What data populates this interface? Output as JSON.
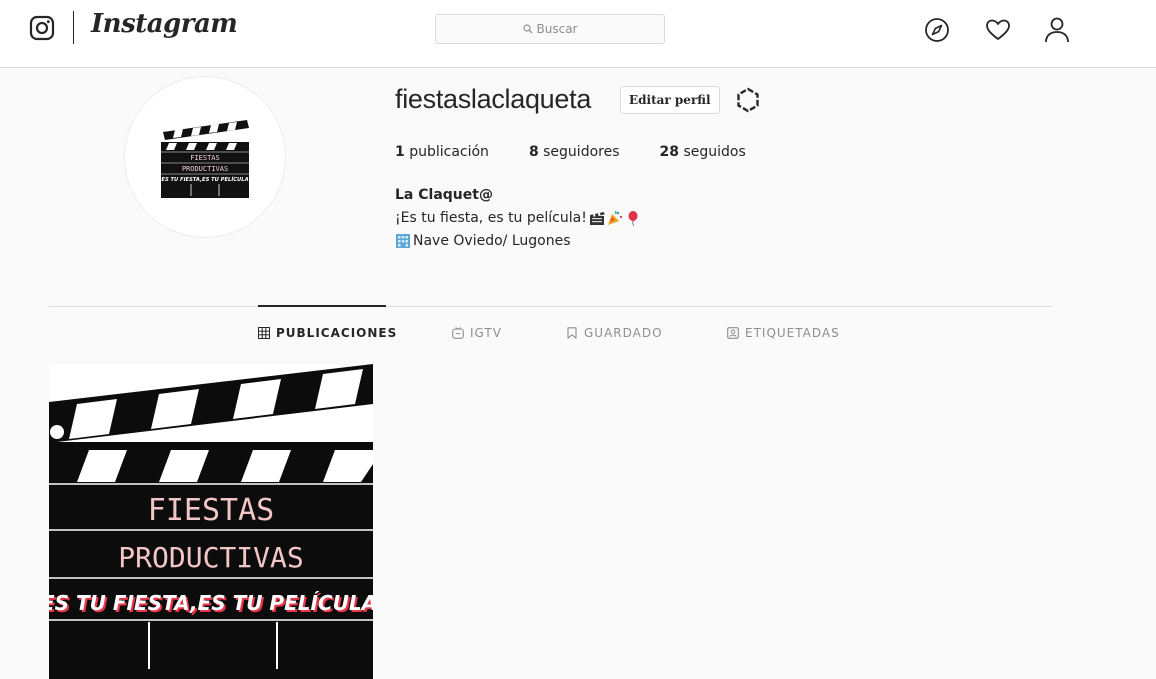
{
  "nav": {
    "wordmark": "Instagram",
    "search_placeholder": "Buscar",
    "icons": [
      "instagram-glyph-icon",
      "compass-icon",
      "heart-icon",
      "person-icon"
    ]
  },
  "profile": {
    "username": "fiestaslaclaqueta",
    "edit_label": "Editar perfil",
    "stats": [
      {
        "count": "1",
        "label": "publicación"
      },
      {
        "count": "8",
        "label": "seguidores"
      },
      {
        "count": "28",
        "label": "seguidos"
      }
    ],
    "full_name": "La Claquet@",
    "bio_line1": "¡Es tu fiesta, es tu película!",
    "bio_line1_emoji": [
      "clapper-board-icon",
      "party-popper-icon",
      "balloon-icon"
    ],
    "bio_line2": "Nave Oviedo/ Lugones",
    "bio_line2_emoji": "building-icon",
    "avatar_text": {
      "line1": "FIESTAS",
      "line2": "PRODUCTIVAS",
      "line3": "ES TU FIESTA,ES TU PELÍCULA"
    }
  },
  "tabs": [
    {
      "label": "PUBLICACIONES",
      "icon": "grid-icon",
      "active": true
    },
    {
      "label": "IGTV",
      "icon": "igtv-icon",
      "active": false
    },
    {
      "label": "GUARDADO",
      "icon": "bookmark-icon",
      "active": false
    },
    {
      "label": "ETIQUETADAS",
      "icon": "tag-person-icon",
      "active": false
    }
  ],
  "post": {
    "line1": "FIESTAS",
    "line2": "PRODUCTIVAS",
    "line3": "ES TU FIESTA,ES TU PELÍCULA"
  },
  "colors": {
    "background": "#fafafa",
    "text": "#262626",
    "muted": "#8e8e8e",
    "border": "#dbdbdb",
    "post_text": "#f2c6c6",
    "post_slogan": "#e8354a"
  }
}
